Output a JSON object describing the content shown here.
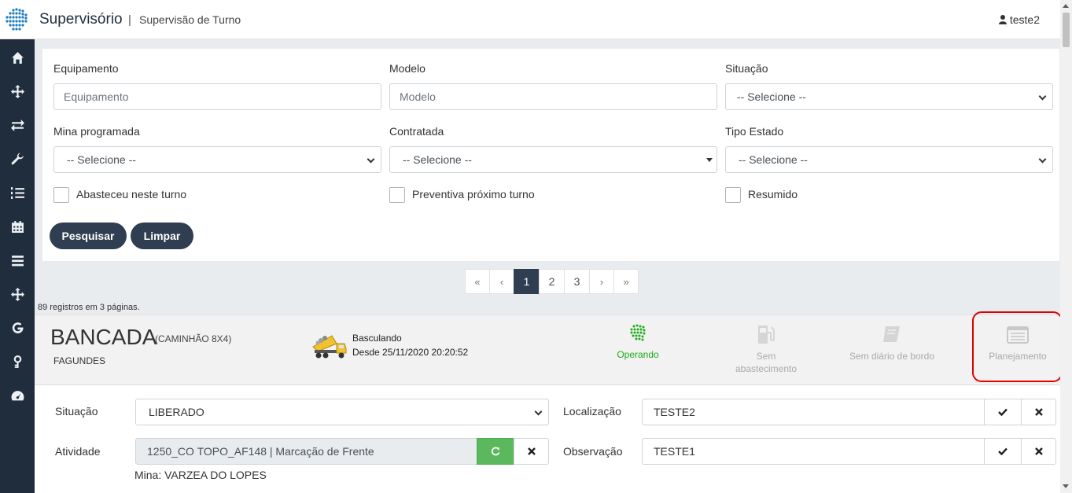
{
  "header": {
    "app_title": "Supervisório",
    "separator": "|",
    "page_subtitle": "Supervisão de Turno",
    "user_name": "teste2"
  },
  "sidebar": {
    "items": [
      {
        "icon": "home-icon"
      },
      {
        "icon": "move-icon"
      },
      {
        "icon": "exchange-icon"
      },
      {
        "icon": "wrench-icon"
      },
      {
        "icon": "list-ordered-icon"
      },
      {
        "icon": "calendar-icon"
      },
      {
        "icon": "menu-icon"
      },
      {
        "icon": "move-icon"
      },
      {
        "icon": "google-icon"
      },
      {
        "icon": "key-icon"
      },
      {
        "icon": "dashboard-icon"
      }
    ]
  },
  "filters": {
    "equipamento_label": "Equipamento",
    "equipamento_placeholder": "Equipamento",
    "modelo_label": "Modelo",
    "modelo_placeholder": "Modelo",
    "situacao_label": "Situação",
    "situacao_value": "-- Selecione --",
    "mina_label": "Mina programada",
    "mina_value": "-- Selecione --",
    "contratada_label": "Contratada",
    "contratada_value": "-- Selecione --",
    "tipo_estado_label": "Tipo Estado",
    "tipo_estado_value": "-- Selecione --",
    "abasteceu_label": "Abasteceu neste turno",
    "preventiva_label": "Preventiva próximo turno",
    "resumido_label": "Resumido",
    "search_button": "Pesquisar",
    "clear_button": "Limpar"
  },
  "pagination": {
    "first": "«",
    "prev": "‹",
    "pages": [
      "1",
      "2",
      "3"
    ],
    "current_page": "1",
    "next": "›",
    "last": "»",
    "records_text": "89 registros em 3 páginas."
  },
  "equipment": {
    "name": "BANCADA",
    "type": "(CAMINHÃO 8X4)",
    "operator": "FAGUNDES",
    "state": "Basculando",
    "since": "Desde 25/11/2020 20:20:52",
    "status_operando": "Operando",
    "status_sem_abast_1": "Sem",
    "status_sem_abast_2": "abastecimento",
    "status_diario": "Sem diário de bordo",
    "status_planejamento": "Planejamento"
  },
  "form": {
    "situacao_label": "Situação",
    "situacao_value": "LIBERADO",
    "localizacao_label": "Localização",
    "localizacao_value": "TESTE2",
    "atividade_label": "Atividade",
    "atividade_value": "1250_CO TOPO_AF148 | Marcação de Frente",
    "observacao_label": "Observação",
    "observacao_value": "TESTE1",
    "mina_text": "Mina: VARZEA DO LOPES"
  },
  "colors": {
    "sidebar_bg": "#1f2d3d",
    "button_dark": "#2f3e50",
    "operando_green": "#1aab1a",
    "refresh_green": "#5cb85c",
    "highlight_red": "#e00000"
  }
}
